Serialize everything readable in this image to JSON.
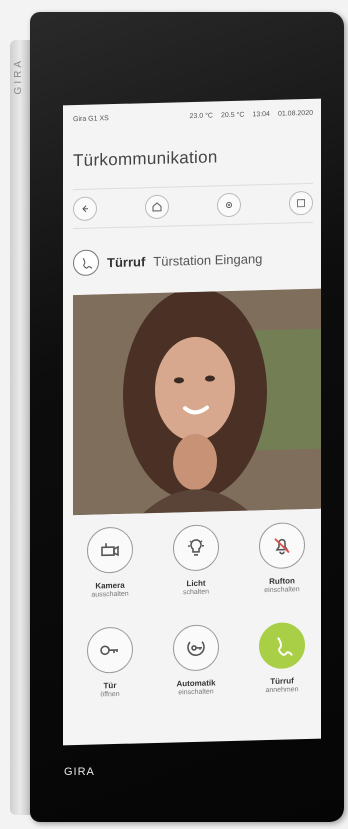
{
  "device": {
    "brand_side": "GIRA",
    "brand_bottom": "GIRA"
  },
  "status": {
    "model": "Gira G1 XS",
    "temp_outdoor": "23.0 °C",
    "temp_indoor": "20.5 °C",
    "time": "13:04",
    "date": "01.08.2020"
  },
  "page": {
    "title": "Türkommunikation"
  },
  "call": {
    "title": "Türruf",
    "subtitle": "Türstation Eingang"
  },
  "controls": [
    {
      "name": "Kamera",
      "sub": "ausschalten",
      "icon": "camera-icon"
    },
    {
      "name": "Licht",
      "sub": "schalten",
      "icon": "light-bulb-icon"
    },
    {
      "name": "Rufton",
      "sub": "einschalten",
      "icon": "bell-muted-icon"
    },
    {
      "name": "Tür",
      "sub": "öffnen",
      "icon": "key-icon"
    },
    {
      "name": "Automatik",
      "sub": "einschalten",
      "icon": "automatic-door-icon"
    },
    {
      "name": "Türruf",
      "sub": "annehmen",
      "icon": "phone-accept-icon"
    }
  ],
  "colors": {
    "accent_green": "#a9cf46"
  }
}
